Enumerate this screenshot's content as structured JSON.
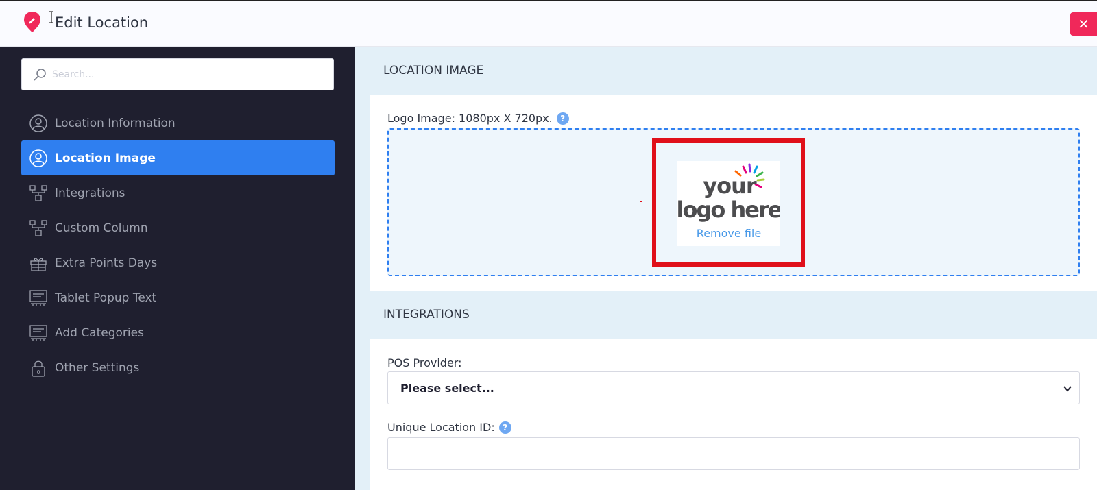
{
  "header": {
    "title": "Edit Location",
    "close_label": "✕"
  },
  "sidebar": {
    "search_placeholder": "Search...",
    "items": [
      {
        "label": "Location Information",
        "icon": "user-circle-icon",
        "active": false
      },
      {
        "label": "Location Image",
        "icon": "user-circle-icon",
        "active": true
      },
      {
        "label": "Integrations",
        "icon": "hierarchy-icon",
        "active": false
      },
      {
        "label": "Custom Column",
        "icon": "hierarchy-icon",
        "active": false
      },
      {
        "label": "Extra Points Days",
        "icon": "gift-icon",
        "active": false
      },
      {
        "label": "Tablet Popup Text",
        "icon": "tablet-icon",
        "active": false
      },
      {
        "label": "Add Categories",
        "icon": "tablet-icon",
        "active": false
      },
      {
        "label": "Other Settings",
        "icon": "lock-icon",
        "active": false
      }
    ]
  },
  "location_image": {
    "section_title": "LOCATION IMAGE",
    "logo_label": "Logo Image: 1080px X 720px.",
    "help_glyph": "?",
    "placeholder_logo_text": [
      "your",
      "logo here"
    ],
    "remove_file": "Remove file"
  },
  "integrations": {
    "section_title": "INTEGRATIONS",
    "pos_label": "POS Provider:",
    "pos_value": "Please select...",
    "unique_id_label": "Unique Location ID:",
    "unique_id_value": ""
  },
  "colors": {
    "accent": "#2f7ff0",
    "sidebar_bg": "#1f1f2f",
    "close": "#f0285a",
    "highlight": "#e0101a"
  }
}
